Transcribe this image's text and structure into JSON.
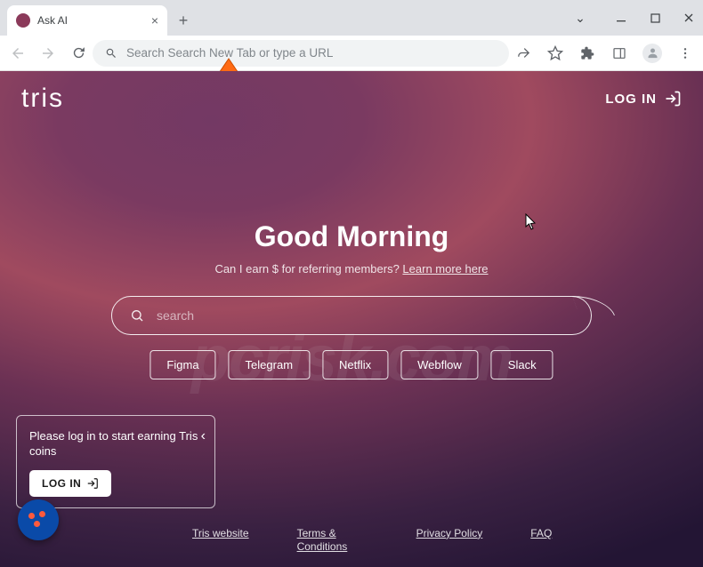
{
  "browser": {
    "tab_title": "Ask AI",
    "address_placeholder": "Search Search New Tab or type a URL"
  },
  "header": {
    "logo": "tris",
    "login_label": "LOG IN"
  },
  "hero": {
    "greeting": "Good Morning",
    "subline_prefix": "Can I earn $ for referring members? ",
    "learn_more": "Learn more here"
  },
  "search": {
    "placeholder": "search"
  },
  "shortcuts": [
    "Figma",
    "Telegram",
    "Netflix",
    "Webflow",
    "Slack"
  ],
  "card": {
    "text": "Please log in to start earning Tris coins",
    "login_label": "LOG IN"
  },
  "footer": {
    "links": [
      "Tris website",
      "Terms & Conditions",
      "Privacy Policy",
      "FAQ"
    ]
  },
  "watermark": "pcrisk.com"
}
